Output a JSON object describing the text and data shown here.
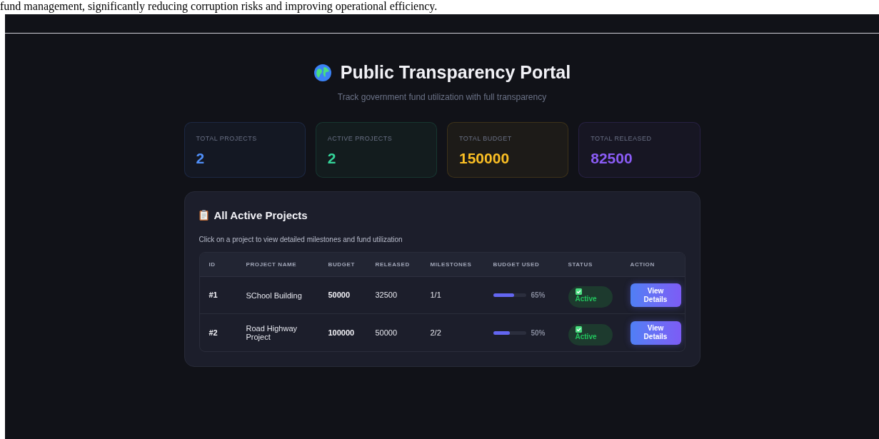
{
  "document_text": "fund management, significantly reducing corruption risks and improving operational efficiency.",
  "header": {
    "title": "Public Transparency Portal",
    "subtitle": "Track government fund utilization with full transparency"
  },
  "stats": [
    {
      "label": "TOTAL PROJECTS",
      "value": "2",
      "color": "#4f8ef7"
    },
    {
      "label": "ACTIVE PROJECTS",
      "value": "2",
      "color": "#34d399"
    },
    {
      "label": "TOTAL BUDGET",
      "value": "150000",
      "color": "#fbbf24"
    },
    {
      "label": "TOTAL RELEASED",
      "value": "82500",
      "color": "#8b5cf6"
    }
  ],
  "projects": {
    "title": "All Active Projects",
    "hint": "Click on a project to view detailed milestones and fund utilization",
    "columns": [
      "ID",
      "PROJECT NAME",
      "BUDGET",
      "RELEASED",
      "MILESTONES",
      "BUDGET USED",
      "STATUS",
      "ACTION"
    ],
    "rows": [
      {
        "id": "#1",
        "name": "SChool Building",
        "budget": "50000",
        "released": "32500",
        "milestones": "1/1",
        "level": 0.65,
        "percent": "65%",
        "status": "Active",
        "action": "View Details"
      },
      {
        "id": "#2",
        "name": "Road Highway Project",
        "budget": "100000",
        "released": "50000",
        "milestones": "2/2",
        "level": 0.5,
        "percent": "50%",
        "status": "Active",
        "action": "View Details"
      }
    ]
  }
}
